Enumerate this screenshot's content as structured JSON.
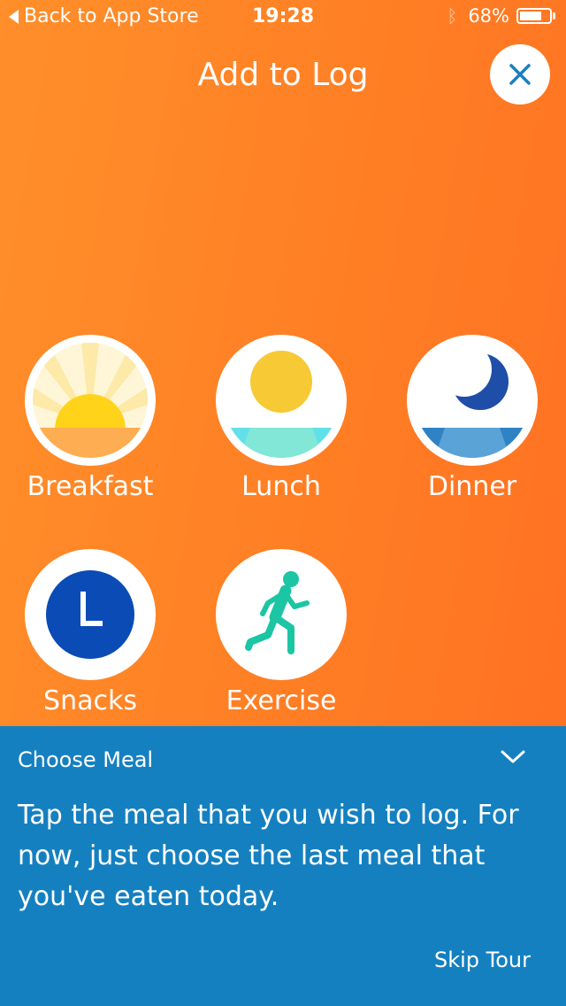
{
  "status_bar": {
    "back_label": "Back to App Store",
    "time": "19:28",
    "battery_text": "68%",
    "battery_level": 0.68
  },
  "header": {
    "title": "Add to Log"
  },
  "log_items": [
    {
      "label": "Breakfast",
      "icon": "sunrise-icon"
    },
    {
      "label": "Lunch",
      "icon": "sun-icon"
    },
    {
      "label": "Dinner",
      "icon": "moon-icon"
    },
    {
      "label": "Snacks",
      "icon": "clock-icon"
    },
    {
      "label": "Exercise",
      "icon": "runner-icon"
    }
  ],
  "tour": {
    "title": "Choose Meal",
    "body": "Tap the meal that you wish to log. For now, just choose the last meal that you've eaten today.",
    "skip_label": "Skip Tour"
  },
  "colors": {
    "background_start": "#ff8f2a",
    "background_end": "#ff6f22",
    "tour_panel": "#1580c0",
    "close_icon": "#1a7fc0",
    "snacks_clock": "#0a4bb6",
    "exercise_runner": "#1cc5a4"
  }
}
